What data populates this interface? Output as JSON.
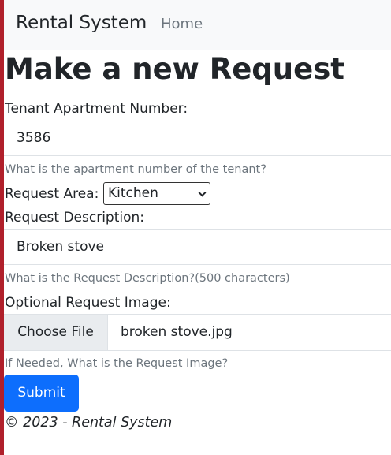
{
  "navbar": {
    "brand": "Rental System",
    "home_link": "Home"
  },
  "form": {
    "title": "Make a new Request",
    "apartment_label": "Tenant Apartment Number:",
    "apartment_value": "3586",
    "apartment_help": "What is the apartment number of the tenant?",
    "area_label": "Request Area:",
    "area_selected": "Kitchen",
    "description_label": "Request Description:",
    "description_value": "Broken stove",
    "description_help": "What is the Request Description?(500 characters)",
    "image_label": "Optional Request Image:",
    "choose_file_label": "Choose File",
    "file_name": "broken stove.jpg",
    "image_help": "If Needed, What is the Request Image?",
    "submit_label": "Submit"
  },
  "footer": {
    "text": "© 2023 - Rental System"
  },
  "colors": {
    "left_accent": "#b0202b",
    "primary_button": "#0d6efd",
    "navbar_bg": "#f8f9fa",
    "muted_text": "#6c757d"
  }
}
